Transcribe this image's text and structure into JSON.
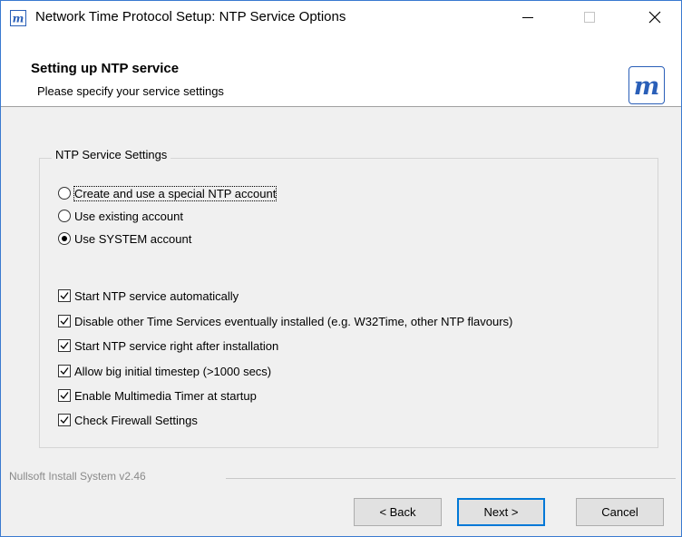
{
  "window": {
    "title": "Network Time Protocol Setup: NTP Service Options"
  },
  "header": {
    "title": "Setting up NTP service",
    "subtitle": "Please specify your service settings"
  },
  "group": {
    "legend": "NTP Service Settings",
    "radios": [
      {
        "label": "Create and use a special NTP account",
        "selected": false
      },
      {
        "label": "Use existing account",
        "selected": false
      },
      {
        "label": "Use SYSTEM account",
        "selected": true
      }
    ],
    "checks": [
      {
        "label": "Start NTP service automatically",
        "checked": true
      },
      {
        "label": "Disable other Time Services eventually installed (e.g. W32Time, other NTP flavours)",
        "checked": true
      },
      {
        "label": "Start NTP service right after installation",
        "checked": true
      },
      {
        "label": "Allow big initial timestep (>1000 secs)",
        "checked": true
      },
      {
        "label": "Enable Multimedia Timer at startup",
        "checked": true
      },
      {
        "label": "Check Firewall Settings",
        "checked": true
      }
    ]
  },
  "footer": {
    "brand": "Nullsoft Install System v2.46"
  },
  "buttons": {
    "back": "< Back",
    "next": "Next >",
    "cancel": "Cancel"
  },
  "colors": {
    "accent": "#0078d7",
    "logo_blue": "#2a5fb8"
  }
}
